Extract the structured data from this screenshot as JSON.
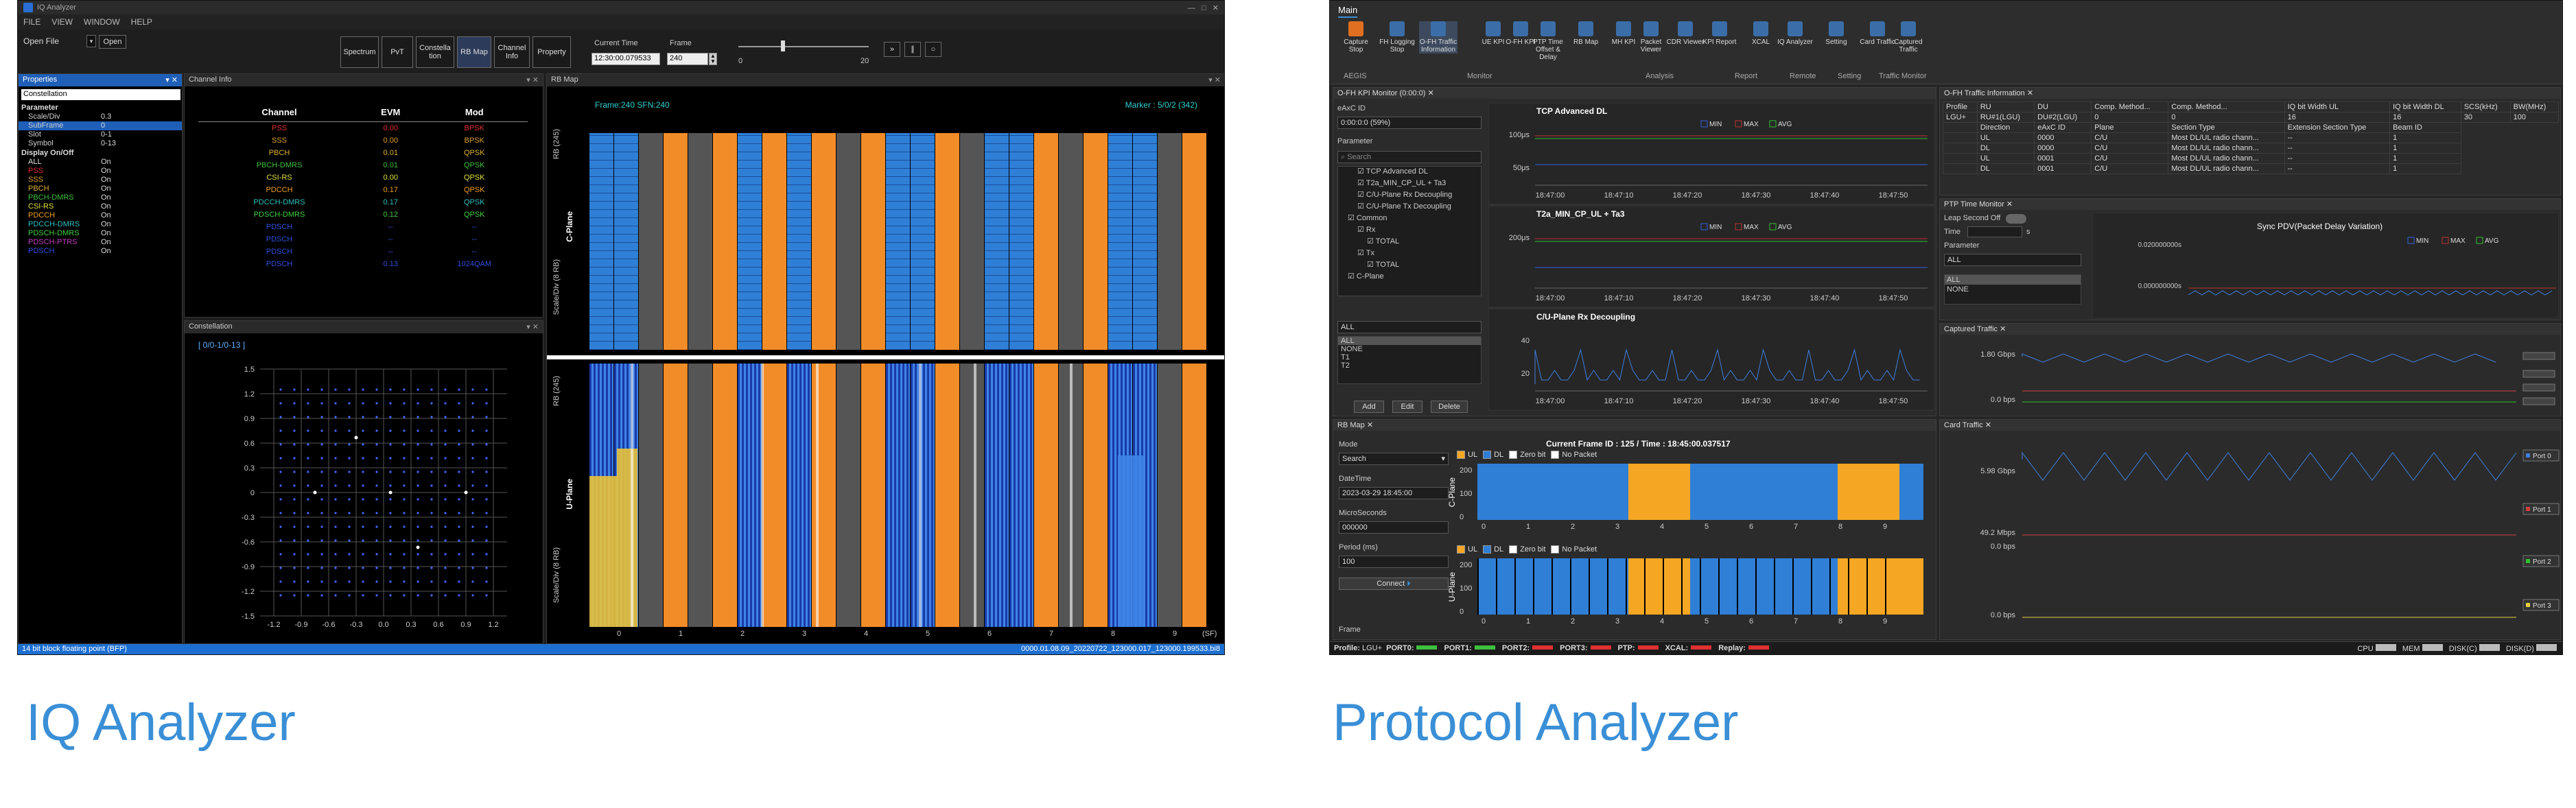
{
  "iq": {
    "app_title": "IQ Analyzer",
    "menu": [
      "FILE",
      "VIEW",
      "WINDOW",
      "HELP"
    ],
    "open_file": "Open File",
    "open_button": "Open",
    "toolbar": [
      "Spectrum",
      "PvT",
      "Constella tion",
      "RB Map",
      "Channel Info",
      "Property"
    ],
    "current_time_label": "Current Time",
    "current_time_value": "12:30:00.079533",
    "frame_label": "Frame",
    "frame_value": "240",
    "slider_min": "0",
    "slider_max": "20",
    "properties": {
      "title": "Properties",
      "selector": "Constellation",
      "groups": [
        {
          "name": "Parameter",
          "rows": [
            {
              "k": "Scale/Div",
              "v": "0.3"
            },
            {
              "k": "SubFrame",
              "v": "0"
            },
            {
              "k": "Slot",
              "v": "0-1"
            },
            {
              "k": "Symbol",
              "v": "0-13"
            }
          ]
        },
        {
          "name": "Display On/Off",
          "rows": [
            {
              "k": "ALL",
              "v": "On",
              "c": "#dddddd"
            },
            {
              "k": "PSS",
              "v": "On",
              "c": "#e03030"
            },
            {
              "k": "SSS",
              "v": "On",
              "c": "#e0a030"
            },
            {
              "k": "PBCH",
              "v": "On",
              "c": "#e0b030"
            },
            {
              "k": "PBCH-DMRS",
              "v": "On",
              "c": "#40c040"
            },
            {
              "k": "CSI-RS",
              "v": "On",
              "c": "#e0e040"
            },
            {
              "k": "PDCCH",
              "v": "On",
              "c": "#f0a020"
            },
            {
              "k": "PDCCH-DMRS",
              "v": "On",
              "c": "#30c0c0"
            },
            {
              "k": "PDSCH-DMRS",
              "v": "On",
              "c": "#40d040"
            },
            {
              "k": "PDSCH-PTRS",
              "v": "On",
              "c": "#c040c0"
            },
            {
              "k": "PDSCH",
              "v": "On",
              "c": "#3050e0"
            }
          ]
        }
      ]
    },
    "channel_info": {
      "title": "Channel Info",
      "headers": [
        "Channel",
        "EVM",
        "Mod"
      ],
      "rows": [
        {
          "ch": "PSS",
          "evm": "0.00",
          "mod": "BPSK",
          "c": "#e03030"
        },
        {
          "ch": "SSS",
          "evm": "0.00",
          "mod": "BPSK",
          "c": "#e0a030"
        },
        {
          "ch": "PBCH",
          "evm": "0.01",
          "mod": "QPSK",
          "c": "#e0b030"
        },
        {
          "ch": "PBCH-DMRS",
          "evm": "0.01",
          "mod": "QPSK",
          "c": "#40c040"
        },
        {
          "ch": "CSI-RS",
          "evm": "0.00",
          "mod": "QPSK",
          "c": "#e0e040"
        },
        {
          "ch": "PDCCH",
          "evm": "0.17",
          "mod": "QPSK",
          "c": "#f0a020"
        },
        {
          "ch": "PDCCH-DMRS",
          "evm": "0.17",
          "mod": "QPSK",
          "c": "#30c0c0"
        },
        {
          "ch": "PDSCH-DMRS",
          "evm": "0.12",
          "mod": "QPSK",
          "c": "#40d040"
        },
        {
          "ch": "PDSCH",
          "evm": "--",
          "mod": "--",
          "c": "#3050e0"
        },
        {
          "ch": "PDSCH",
          "evm": "--",
          "mod": "--",
          "c": "#3050e0"
        },
        {
          "ch": "PDSCH",
          "evm": "--",
          "mod": "--",
          "c": "#3050e0"
        },
        {
          "ch": "PDSCH",
          "evm": "0.13",
          "mod": "1024QAM",
          "c": "#3050e0"
        }
      ]
    },
    "constellation": {
      "title": "Constellation",
      "subtitle": "[ 0/0-1/0-13 ]",
      "yticks": [
        "1.5",
        "1.2",
        "0.9",
        "0.6",
        "0.3",
        "0",
        "-0.3",
        "-0.6",
        "-0.9",
        "-1.2",
        "-1.5"
      ],
      "xticks": [
        "-1.2",
        "-0.9",
        "-0.6",
        "-0.3",
        "0.0",
        "0.3",
        "0.6",
        "0.9",
        "1.2"
      ]
    },
    "rbmap": {
      "title": "RB Map",
      "frame_info": "Frame:240   SFN:240",
      "marker": "Marker : 5/0/2 (342)",
      "cplane_label": "C-Plane",
      "uplane_label": "U-Plane",
      "rb_axis": "RB (245)",
      "scale_axis": "Scale/Div (8 RB)",
      "xticks": [
        "0",
        "1",
        "2",
        "3",
        "4",
        "5",
        "6",
        "7",
        "8",
        "9"
      ],
      "sf_label": "(SF)"
    },
    "status_left": "14 bit block floating point (BFP)",
    "status_right": "0000.01.08.09_20220722_123000.017_123000.199533.bi8"
  },
  "pa": {
    "ribbon_tab": "Main",
    "ribbon_buttons": [
      "Capture Stop",
      "FH Logging Stop",
      "O-FH Traffic Information",
      "UE KPI",
      "O-FH KPI",
      "PTP Time Offset & Delay",
      "RB Map",
      "MH KPI",
      "Packet Viewer",
      "CDR Viewer",
      "KPI Report",
      "XCAL",
      "IQ Analyzer",
      "Setting",
      "Card Traffic",
      "Captured Traffic"
    ],
    "ribbon_groups": [
      "AEGIS",
      "Monitor",
      "Analysis",
      "Report",
      "Remote",
      "Setting",
      "Traffic Monitor"
    ],
    "kpi": {
      "title": "O-FH KPI Monitor (0:00:0)",
      "eaxc_label": "eAxC ID",
      "eaxc_value": "0:00:0:0 (59%)",
      "parameter": "Parameter",
      "search": "Search",
      "tree": [
        "TCP Advanced DL",
        "T2a_MIN_CP_UL + Ta3",
        "C/U-Plane Rx Decoupling",
        "C/U-Plane Tx Decoupling",
        "Common",
        "Rx",
        "TOTAL",
        "Tx",
        "TOTAL",
        "C-Plane"
      ],
      "list": [
        "ALL",
        "ALL",
        "NONE",
        "T1",
        "T2"
      ],
      "buttons": [
        "Add",
        "Edit",
        "Delete"
      ],
      "chart1": {
        "title": "TCP Advanced DL",
        "y": [
          "100μs",
          "50μs"
        ]
      },
      "chart2": {
        "title": "T2a_MIN_CP_UL + Ta3",
        "y": [
          "200μs"
        ]
      },
      "chart3": {
        "title": "C/U-Plane Rx Decoupling",
        "y": [
          "40",
          "20"
        ]
      },
      "legend": [
        "MIN",
        "MAX",
        "AVG"
      ],
      "times": [
        "18:47:00",
        "18:47:10",
        "18:47:20",
        "18:47:30",
        "18:47:40",
        "18:47:50"
      ]
    },
    "traffic": {
      "title": "O-FH Traffic Information",
      "headers": [
        "Profile",
        "RU",
        "DU",
        "Comp. Method...",
        "Comp. Method...",
        "IQ bit Width UL",
        "IQ bit Width DL",
        "SCS(kHz)",
        "BW(MHz)"
      ],
      "row": [
        "LGU+",
        "RU#1(LGU)",
        "DU#2(LGU)",
        "0",
        "0",
        "16",
        "16",
        "30",
        "100"
      ],
      "sub_headers": [
        "Direction",
        "eAxC ID",
        "Plane",
        "Section Type",
        "Extension Section Type",
        "Beam ID"
      ],
      "sub_rows": [
        [
          "UL",
          "0000",
          "C/U",
          "Most DL/UL radio chann...",
          "--",
          "1"
        ],
        [
          "DL",
          "0000",
          "C/U",
          "Most DL/UL radio chann...",
          "--",
          "1"
        ],
        [
          "UL",
          "0001",
          "C/U",
          "Most DL/UL radio chann...",
          "--",
          "1"
        ],
        [
          "DL",
          "0001",
          "C/U",
          "Most DL/UL radio chann...",
          "--",
          "1"
        ]
      ]
    },
    "ptp": {
      "title": "PTP Time Monitor",
      "leap": "Leap Second Off",
      "time": "Time",
      "unit": "s",
      "parameter": "Parameter",
      "all": "ALL",
      "list": [
        "ALL",
        "NONE"
      ],
      "chart_title": "Sync PDV(Packet Delay Variation)",
      "y": [
        "0.020000000s",
        "0.000000000s"
      ]
    },
    "captured": {
      "title": "Captured Traffic",
      "y": [
        "1.80 Gbps",
        "0.0 bps"
      ]
    },
    "card": {
      "title": "Card Traffic",
      "y": [
        "5.98 Gbps",
        "49.2 Mbps",
        "0.0 bps",
        "0.0 bps"
      ],
      "ports": [
        "Port 0",
        "Port 1",
        "Port 2",
        "Port 3"
      ]
    },
    "rbmap": {
      "title": "RB Map",
      "mode_label": "Mode",
      "mode_value": "Search",
      "datetime_label": "DateTime",
      "datetime_value": "2023-03-29 18:45:00",
      "ms_label": "MicroSeconds",
      "ms_value": "000000",
      "period_label": "Period (ms)",
      "period_value": "100",
      "connect": "Connect",
      "frame": "Frame",
      "current": "Current Frame ID : 125 / Time : 18:45:00.037517",
      "legend": [
        "UL",
        "DL",
        "Zero bit",
        "No Packet"
      ],
      "cplane": "C-Plane",
      "uplane": "U-Plane",
      "yticks": [
        "200",
        "100",
        "0"
      ],
      "xticks": [
        "0",
        "1",
        "2",
        "3",
        "4",
        "5",
        "6",
        "7",
        "8",
        "9"
      ]
    },
    "status": {
      "profile": "Profile:",
      "profile_value": "LGU+",
      "ports": [
        "PORT0:",
        "PORT1:",
        "PORT2:",
        "PORT3:",
        "PTP:",
        "XCAL:",
        "Replay:"
      ],
      "cpu": "CPU",
      "mem": "MEM",
      "disk_c": "DISK(C)",
      "disk_d": "DISK(D)"
    }
  },
  "captions": {
    "left": "IQ Analyzer",
    "right": "Protocol Analyzer"
  }
}
